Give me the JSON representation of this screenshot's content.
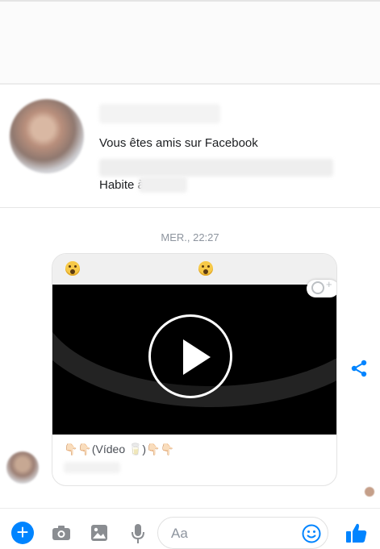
{
  "profile": {
    "friends_text": "Vous êtes amis sur Facebook",
    "lives_prefix": "Habite à"
  },
  "conversation": {
    "timestamp": "MER., 22:27",
    "attachment": {
      "caption": "👇🏻👇🏻(Vídeo 🥛)👇🏻👇🏻"
    }
  },
  "composer": {
    "placeholder": "Aa"
  },
  "colors": {
    "accent": "#0084ff",
    "video_bg": "#000000"
  },
  "icons": [
    "plus-icon",
    "camera-icon",
    "image-icon",
    "microphone-icon",
    "emoji-icon",
    "thumbs-up-icon",
    "share-icon",
    "play-icon",
    "add-reaction-icon"
  ]
}
